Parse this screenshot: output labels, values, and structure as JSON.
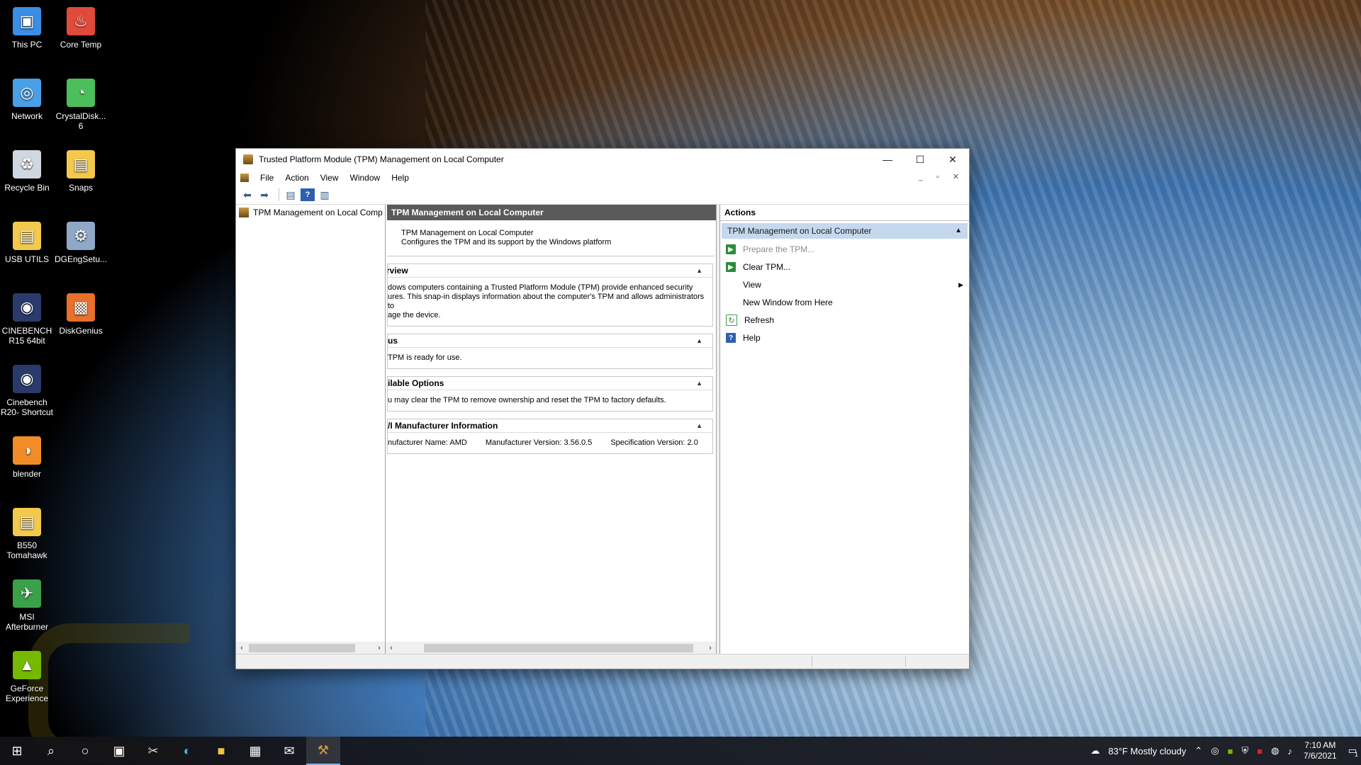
{
  "desktop": {
    "icons": [
      {
        "label": "This PC",
        "icon": "this-pc-icon"
      },
      {
        "label": "Core Temp",
        "icon": "core-temp-icon"
      },
      {
        "label": "Network",
        "icon": "network-icon"
      },
      {
        "label": "CrystalDisk...\n6",
        "icon": "crystaldisk-icon"
      },
      {
        "label": "Recycle Bin",
        "icon": "recycle-bin-icon"
      },
      {
        "label": "Snaps",
        "icon": "folder-icon"
      },
      {
        "label": "USB UTILS",
        "icon": "folder-icon"
      },
      {
        "label": "DGEngSetu...",
        "icon": "dgengsetup-icon"
      },
      {
        "label": "CINEBENCH\nR15 64bit",
        "icon": "cinebench-icon"
      },
      {
        "label": "DiskGenius",
        "icon": "diskgenius-icon"
      },
      {
        "label": "Cinebench\nR20- Shortcut",
        "icon": "cinebench-icon"
      },
      {
        "label": "blender",
        "icon": "blender-icon"
      },
      {
        "label": "B550\nTomahawk",
        "icon": "folder-icon"
      },
      {
        "label": "MSI\nAfterburner",
        "icon": "msi-afterburner-icon"
      },
      {
        "label": "GeForce\nExperience",
        "icon": "geforce-icon"
      }
    ]
  },
  "window": {
    "title": "Trusted Platform Module (TPM) Management on Local Computer",
    "controls": {
      "minimize": "—",
      "maximize": "☐",
      "close": "✕"
    },
    "menu": [
      "File",
      "Action",
      "View",
      "Window",
      "Help"
    ],
    "mdi_controls": "_ ▫ ✕",
    "tree": {
      "item": "TPM Management on Local Comp"
    },
    "center": {
      "header": "TPM Management on Local Computer",
      "intro_title": "TPM Management on Local Computer",
      "intro_desc": "Configures the TPM and its support by the Windows platform",
      "sections": {
        "overview": {
          "title": "rview",
          "body": "dows computers containing a Trusted Platform Module (TPM) provide enhanced security\nures. This snap-in displays information about the computer's TPM and allows administrators to\nage the device."
        },
        "status": {
          "title": "us",
          "body": "TPM is ready for use."
        },
        "options": {
          "title": "ilable Options",
          "body": "u may clear the TPM to remove ownership and reset the TPM to factory defaults."
        },
        "manufacturer": {
          "title": "/I Manufacturer Information",
          "name": "nufacturer Name:  AMD",
          "version": "Manufacturer Version:  3.56.0.5",
          "spec": "Specification Version:  2.0"
        }
      }
    },
    "actions": {
      "header": "Actions",
      "group": "TPM Management on Local Computer",
      "items": [
        {
          "label": "Prepare the TPM...",
          "icon": "green-arrow-icon",
          "disabled": true
        },
        {
          "label": "Clear TPM...",
          "icon": "green-arrow-icon",
          "disabled": false
        },
        {
          "label": "View",
          "icon": "",
          "disabled": false,
          "submenu": true
        },
        {
          "label": "New Window from Here",
          "icon": "",
          "disabled": false
        },
        {
          "label": "Refresh",
          "icon": "refresh-icon",
          "disabled": false
        },
        {
          "label": "Help",
          "icon": "help-icon",
          "disabled": false
        }
      ]
    }
  },
  "taskbar": {
    "weather": "83°F  Mostly cloudy",
    "time": "7:10 AM",
    "date": "7/6/2021",
    "notification_count": "1"
  },
  "colors": {
    "actions_group_bg": "#c4d8ee",
    "center_header_bg": "#5a5a5a",
    "taskbar_bg": "#141418"
  }
}
